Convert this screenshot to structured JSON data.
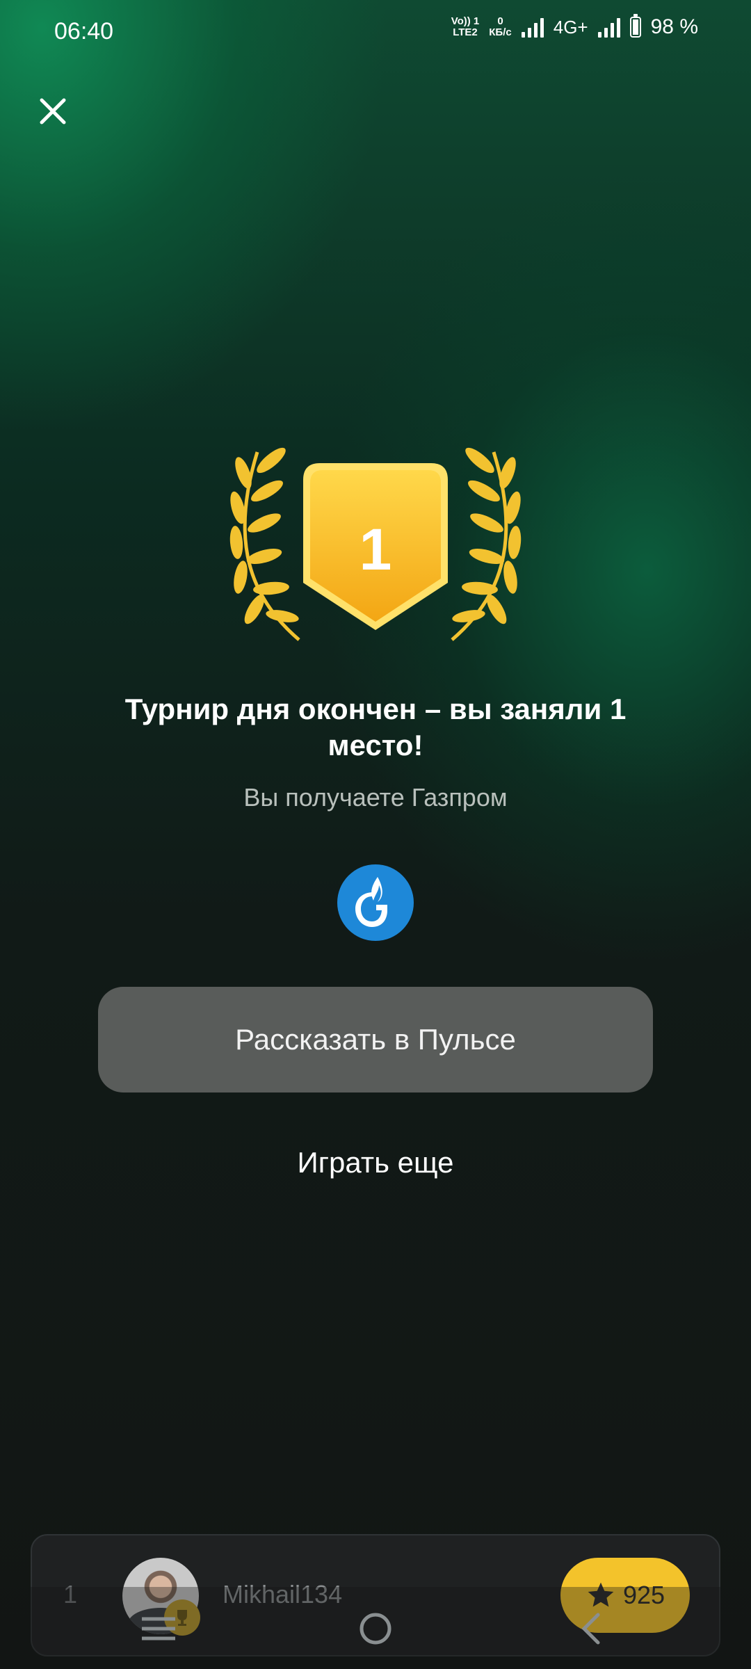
{
  "status_bar": {
    "time": "06:40",
    "volte_line1": "Vo)) 1",
    "volte_line2": "LTE2",
    "speed_value": "0",
    "speed_unit": "КБ/с",
    "network": "4G+",
    "battery": "98 %"
  },
  "close_icon": "close-icon",
  "award": {
    "place_number": "1",
    "colors": {
      "gold": "#F6B21A",
      "laurel": "#F2C230"
    }
  },
  "result": {
    "title": "Турнир дня окончен – вы заняли 1 место!",
    "subtitle": "Вы получаете Газпром",
    "reward_icon": "gazprom-logo"
  },
  "actions": {
    "share_label": "Рассказать в Пульсе",
    "play_again_label": "Играть еще"
  },
  "player": {
    "rank": "1",
    "username": "Mikhail134",
    "score": "925",
    "colors": {
      "score_pill": "#F3C32B"
    }
  },
  "nav": {
    "menu_icon": "menu-icon",
    "home_icon": "home-circle-icon",
    "back_icon": "back-chevron-icon"
  }
}
